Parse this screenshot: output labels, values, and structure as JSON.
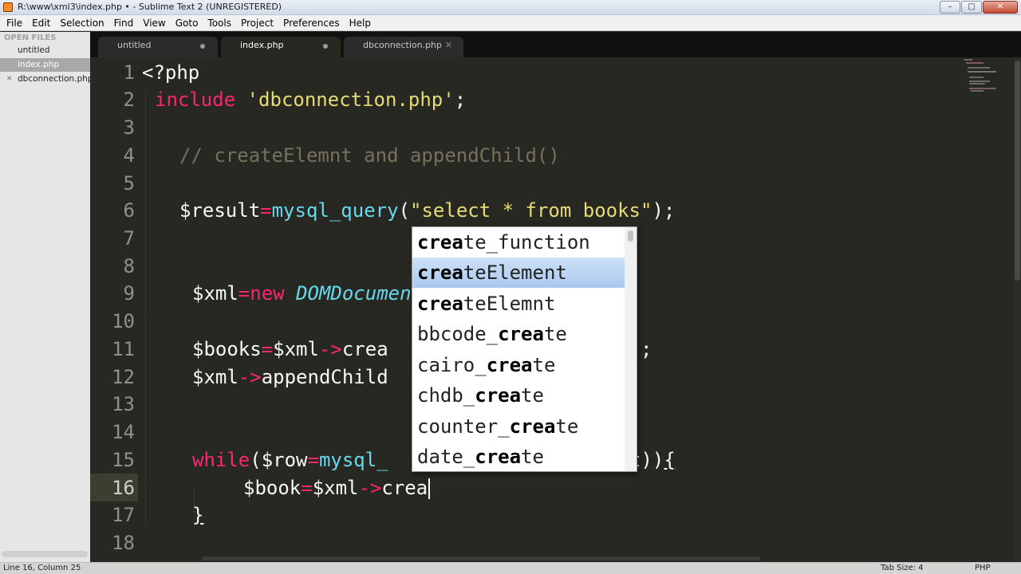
{
  "window": {
    "title": "R:\\www\\xml3\\index.php • - Sublime Text 2 (UNREGISTERED)",
    "buttons": {
      "minimize": "–",
      "maximize": "□",
      "close": "✕"
    }
  },
  "menu": [
    "File",
    "Edit",
    "Selection",
    "Find",
    "View",
    "Goto",
    "Tools",
    "Project",
    "Preferences",
    "Help"
  ],
  "sidebar": {
    "header": "OPEN FILES",
    "files": [
      {
        "name": "untitled",
        "active": false
      },
      {
        "name": "index.php",
        "active": true
      },
      {
        "name": "dbconnection.php",
        "active": false
      }
    ]
  },
  "tabs": [
    {
      "label": "untitled",
      "state": "modified"
    },
    {
      "label": "index.php",
      "state": "modified-active"
    },
    {
      "label": "dbconnection.php",
      "state": "saved"
    }
  ],
  "editor": {
    "line_numbers": [
      "1",
      "2",
      "3",
      "4",
      "5",
      "6",
      "7",
      "8",
      "9",
      "10",
      "11",
      "12",
      "13",
      "14",
      "15",
      "16",
      "17",
      "18"
    ],
    "current_line": "16",
    "lines": {
      "l1": "<?php",
      "l2_kw": "include",
      "l2_str": "'dbconnection.php'",
      "l2_end": ";",
      "l4": "// createElemnt and appendChild()",
      "l6_var": "$result",
      "l6_eq": "=",
      "l6_fn": "mysql_query",
      "l6_open": "(",
      "l6_str": "\"select * from books\"",
      "l6_end": ");",
      "l9_var": "$xml",
      "l9_eq": "=",
      "l9_kw": "new",
      "l9_cls": "DOMDocument",
      "l11_var": "$books",
      "l11_eq": "=",
      "l11_obj": "$xml",
      "l11_arrow": "->",
      "l11_call": "crea",
      "l11_end": ";",
      "l12_obj": "$xml",
      "l12_arrow": "->",
      "l12_call": "appendChild",
      "l15_kw": "while",
      "l15_a": "(",
      "l15_var": "$row",
      "l15_eq": "=",
      "l15_fn": "mysql_",
      "l15_tail": "t))",
      "l15_brace": "{",
      "l16_var": "$book",
      "l16_eq": "=",
      "l16_obj": "$xml",
      "l16_arrow": "->",
      "l16_call": "crea",
      "l17": "}"
    }
  },
  "autocomplete": {
    "selected_index": 1,
    "items": [
      {
        "pre": "",
        "match": "crea",
        "post": "te_function"
      },
      {
        "pre": "",
        "match": "crea",
        "post": "teElement"
      },
      {
        "pre": "",
        "match": "crea",
        "post": "teElemnt"
      },
      {
        "pre": "bbcode_",
        "match": "crea",
        "post": "te"
      },
      {
        "pre": "cairo_",
        "match": "crea",
        "post": "te"
      },
      {
        "pre": "chdb_",
        "match": "crea",
        "post": "te"
      },
      {
        "pre": "counter_",
        "match": "crea",
        "post": "te"
      },
      {
        "pre": "date_",
        "match": "crea",
        "post": "te"
      }
    ]
  },
  "statusbar": {
    "position": "Line 16, Column 25",
    "tab_size": "Tab Size: 4",
    "syntax": "PHP"
  },
  "colors": {
    "background": "#272822",
    "keyword": "#f92672",
    "string": "#e6db74",
    "comment": "#75715e",
    "function": "#66d9ef",
    "text": "#f8f8f2",
    "selection": "#a9c8ef"
  }
}
